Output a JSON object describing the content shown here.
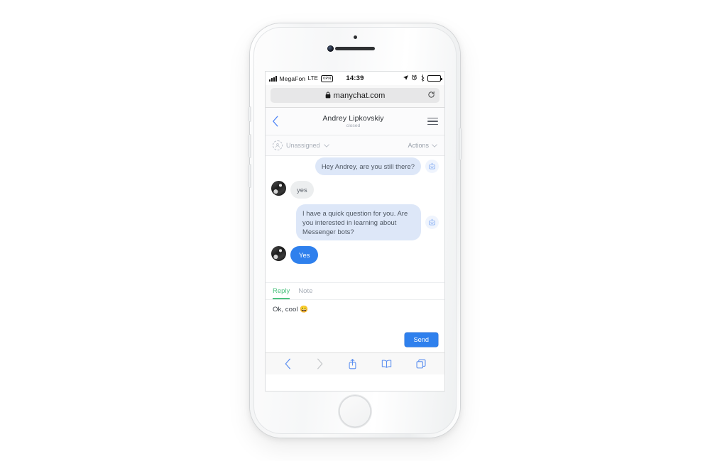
{
  "device": {
    "type": "iphone-white-silver",
    "hardware": {
      "speaker": "earpiece-speaker",
      "camera": "front-camera",
      "sensor": "proximity-sensor",
      "home": "home-button",
      "buttons": [
        "silent-switch",
        "volume-up",
        "volume-down",
        "power"
      ]
    }
  },
  "statusbar": {
    "carrier": "MegaFon",
    "network": "LTE",
    "vpn": "VPN",
    "time": "14:39",
    "icons": [
      "location-arrow-icon",
      "alarm-clock-icon",
      "bluetooth-icon",
      "battery-icon"
    ]
  },
  "browser": {
    "url": "manychat.com",
    "lock_icon": "lock-icon",
    "reload_icon": "reload-icon",
    "toolbar": [
      {
        "name": "back-icon",
        "enabled": true
      },
      {
        "name": "forward-icon",
        "enabled": false
      },
      {
        "name": "share-icon",
        "enabled": true
      },
      {
        "name": "bookmarks-icon",
        "enabled": true
      },
      {
        "name": "tabs-icon",
        "enabled": true
      }
    ]
  },
  "chat_header": {
    "back_icon": "back-chevron-icon",
    "title": "Andrey Lipkovskiy",
    "status": "closed",
    "menu_icon": "hamburger-menu-icon"
  },
  "assign_bar": {
    "avatar_icon": "unassigned-person-icon",
    "assignee": "Unassigned",
    "assignee_chevron": "chevron-down-icon",
    "actions": "Actions",
    "actions_chevron": "chevron-down-icon"
  },
  "conversation": {
    "messages": [
      {
        "direction": "out",
        "text": "Hey Andrey, are you still there?",
        "badge": "bot-icon",
        "style": "bubble"
      },
      {
        "direction": "in",
        "text": "yes",
        "avatar": "user-avatar",
        "style": "bubble"
      },
      {
        "direction": "out",
        "text": "I have a quick question for you. Are you interested in learning about Messenger bots?",
        "badge": "bot-icon",
        "style": "bubble"
      },
      {
        "direction": "in",
        "text": "Yes",
        "avatar": "user-avatar",
        "style": "quick-reply"
      }
    ]
  },
  "reply_panel": {
    "tabs": [
      {
        "label": "Reply",
        "active": true
      },
      {
        "label": "Note",
        "active": false
      }
    ],
    "draft": "Ok, cool 😀",
    "send_label": "Send"
  },
  "colors": {
    "accent_blue": "#2f80ed",
    "bubble_out": "#dde7f8",
    "bubble_in": "#eceeef",
    "tab_active_green": "#4cc27f",
    "link_blue": "#4d84f7",
    "page_bg": "#ffffff"
  }
}
